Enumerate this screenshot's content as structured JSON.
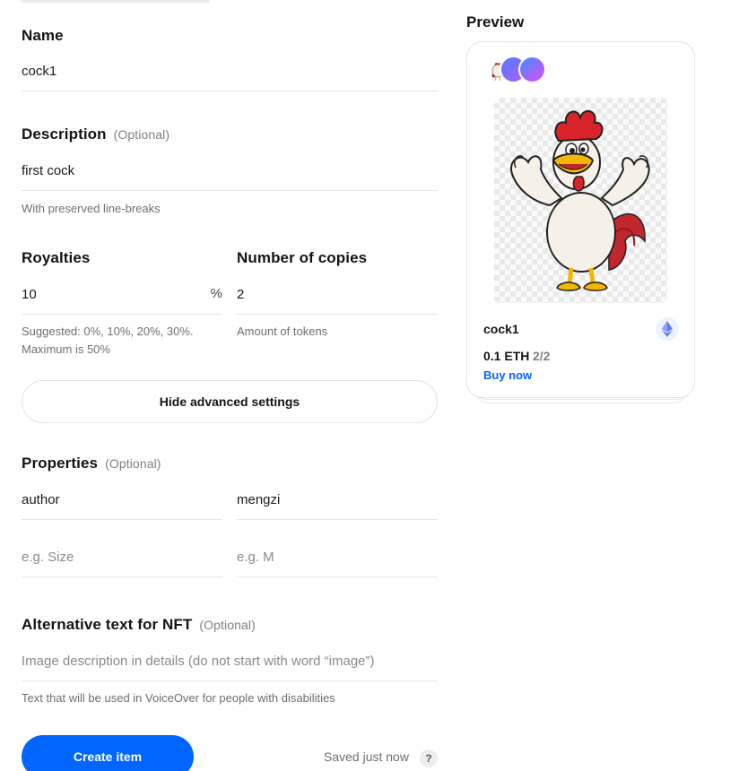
{
  "form": {
    "name": {
      "label": "Name",
      "value": "cock1"
    },
    "description": {
      "label": "Description",
      "optional": "(Optional)",
      "value": "first cock",
      "hint": "With preserved line-breaks"
    },
    "royalties": {
      "label": "Royalties",
      "value": "10",
      "suffix": "%",
      "hint_line1": "Suggested: 0%, 10%, 20%, 30%.",
      "hint_line2": "Maximum is 50%"
    },
    "copies": {
      "label": "Number of copies",
      "value": "2",
      "hint": "Amount of tokens"
    },
    "advanced_button": "Hide advanced settings",
    "properties": {
      "label": "Properties",
      "optional": "(Optional)",
      "rows": [
        {
          "key": "author",
          "value": "mengzi"
        }
      ],
      "placeholder_key": "e.g. Size",
      "placeholder_value": "e.g. M"
    },
    "alt_text": {
      "label": "Alternative text for NFT",
      "optional": "(Optional)",
      "placeholder": "Image description in details (do not start with word “image”)",
      "hint": "Text that will be used in VoiceOver for people with disabilities"
    },
    "create_button": "Create item",
    "saved_status": "Saved just now",
    "help_label": "?"
  },
  "preview": {
    "title": "Preview",
    "card": {
      "name": "cock1",
      "price": "0.1 ETH",
      "copies": "2/2",
      "buy_label": "Buy now",
      "chain_icon": "ethereum-icon"
    },
    "colors": {
      "accent": "#0066ff",
      "avatar_gradient_start": "#4e7cff",
      "avatar_gradient_end": "#b35cff"
    }
  }
}
